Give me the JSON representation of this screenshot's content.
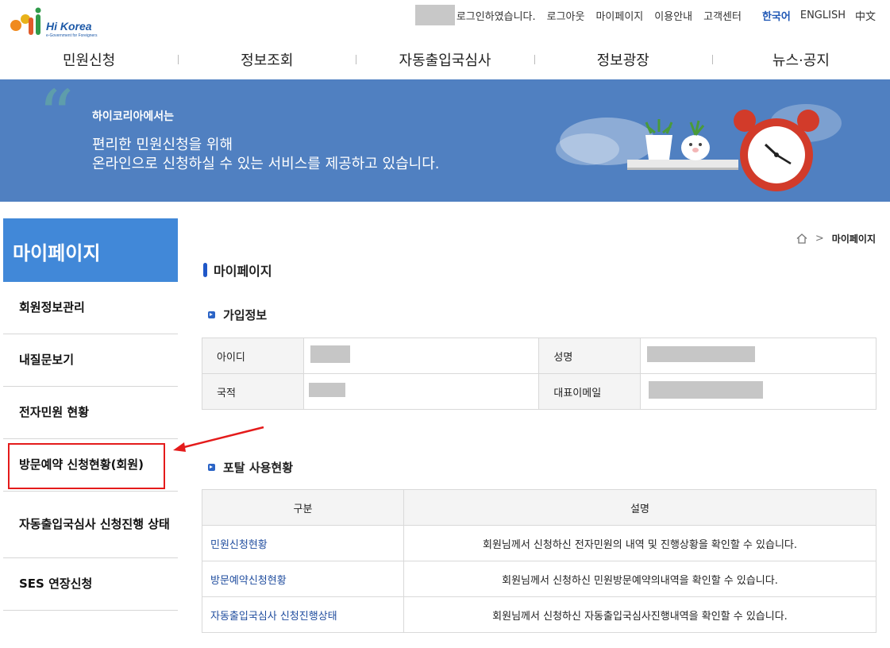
{
  "header": {
    "logo_text": "Hi Korea",
    "logo_subtext": "e-Government for Foreigners",
    "login_message": "로그인하였습니다.",
    "util_links": [
      "로그아웃",
      "마이페이지",
      "이용안내",
      "고객센터"
    ],
    "languages": [
      {
        "label": "한국어",
        "active": true
      },
      {
        "label": "ENGLISH",
        "active": false
      },
      {
        "label": "中文",
        "active": false
      }
    ]
  },
  "gnb": [
    "민원신청",
    "정보조회",
    "자동출입국심사",
    "정보광장",
    "뉴스·공지"
  ],
  "banner": {
    "small": "하이코리아에서는",
    "line1": "편리한 민원신청을 위해",
    "line2": "온라인으로 신청하실 수 있는 서비스를 제공하고 있습니다."
  },
  "sidebar": {
    "title": "마이페이지",
    "items": [
      {
        "label": "회원정보관리"
      },
      {
        "label": "내질문보기"
      },
      {
        "label": "전자민원 현황"
      },
      {
        "label": "방문예약 신청현황(회원)"
      },
      {
        "label": "자동출입국심사 신청진행 상태"
      },
      {
        "label": "SES 연장신청"
      }
    ]
  },
  "breadcrumb": {
    "current": "마이페이지"
  },
  "main": {
    "title": "마이페이지",
    "join_info": {
      "title": "가입정보",
      "id_label": "아이디",
      "name_label": "성명",
      "nationality_label": "국적",
      "email_label": "대표이메일"
    },
    "usage": {
      "title": "포탈 사용현황",
      "col_category": "구분",
      "col_description": "설명",
      "rows": [
        {
          "category": "민원신청현황",
          "description": "회원님께서 신청하신 전자민원의 내역 및 진행상황을 확인할 수 있습니다."
        },
        {
          "category": "방문예약신청현황",
          "description": "회원님께서 신청하신 민원방문예약의내역을 확인할 수 있습니다."
        },
        {
          "category": "자동출입국심사 신청진행상태",
          "description": "회원님께서 신청하신 자동출입국심사진행내역을 확인할 수 있습니다."
        }
      ]
    }
  },
  "colors": {
    "banner_bg": "#5080c1",
    "sidebar_title_bg": "#4188d8",
    "highlight_red": "#e41b1b",
    "link_blue": "#1f4c9e"
  }
}
